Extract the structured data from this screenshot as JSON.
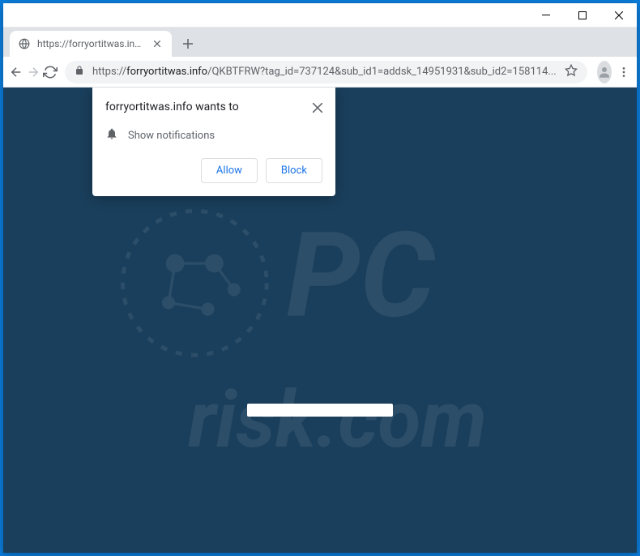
{
  "window": {
    "minimize_icon": "minimize-icon",
    "maximize_icon": "maximize-icon",
    "close_icon": "close-icon"
  },
  "tab": {
    "title": "https://forryortitwas.info/QKBTF",
    "favicon": "globe-icon"
  },
  "url": {
    "protocol": "https://",
    "host": "forryortitwas.info",
    "path": "/QKBTFRW?tag_id=737124&sub_id1=addsk_14951931&sub_id2=158114..."
  },
  "permission": {
    "title": "forryortitwas.info wants to",
    "request": "Show notifications",
    "allow": "Allow",
    "block": "Block"
  },
  "watermark": {
    "line1": "PC",
    "line2": "risk.com"
  }
}
